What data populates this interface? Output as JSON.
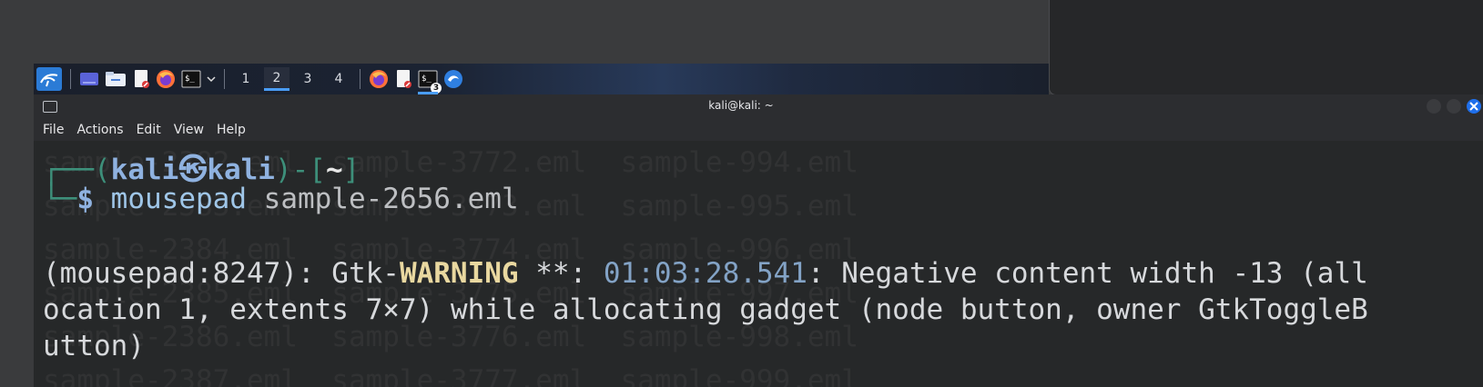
{
  "panel": {
    "workspaces": [
      "1",
      "2",
      "3",
      "4"
    ],
    "active_workspace": "2",
    "terminal_badge": "3"
  },
  "window": {
    "title": "kali@kali: ~"
  },
  "menu": {
    "file": "File",
    "actions": "Actions",
    "edit": "Edit",
    "view": "View",
    "help": "Help"
  },
  "prompt": {
    "open_paren": "┌──(",
    "user": "kali",
    "host": "kali",
    "close": ")-[",
    "dir": "~",
    "close2": "]",
    "second_line": "└─",
    "dollar": "$",
    "command": "mousepad",
    "argument": "sample-2656.eml"
  },
  "output": {
    "line1_prefix": "(mousepad:8247): Gtk-",
    "line1_warning": "WARNING",
    "line1_stars": " **: ",
    "line1_time": "01:03:28.541",
    "line1_rest": ": Negative content width -13 (all",
    "line2": "ocation 1, extents 7×7) while allocating gadget (node button, owner GtkToggleB",
    "line3": "utton)"
  },
  "background_listing": [
    "sample-2382.eml  sample-3772.eml  sample-994.eml",
    "sample-2383.eml  sample-3773.eml  sample-995.eml",
    "sample-2384.eml  sample-3774.eml  sample-996.eml",
    "sample-2385.eml  sample-3775.eml  sample-997.eml",
    "sample-2386.eml  sample-3776.eml  sample-998.eml",
    "sample-2387.eml  sample-3777.eml  sample-999.eml"
  ],
  "colors": {
    "terminal_bg": "#262829",
    "accent": "#4a9df8",
    "prompt_green": "#3d8f7a",
    "prompt_blue": "#8fb2e0",
    "warning": "#e9d8a0"
  }
}
